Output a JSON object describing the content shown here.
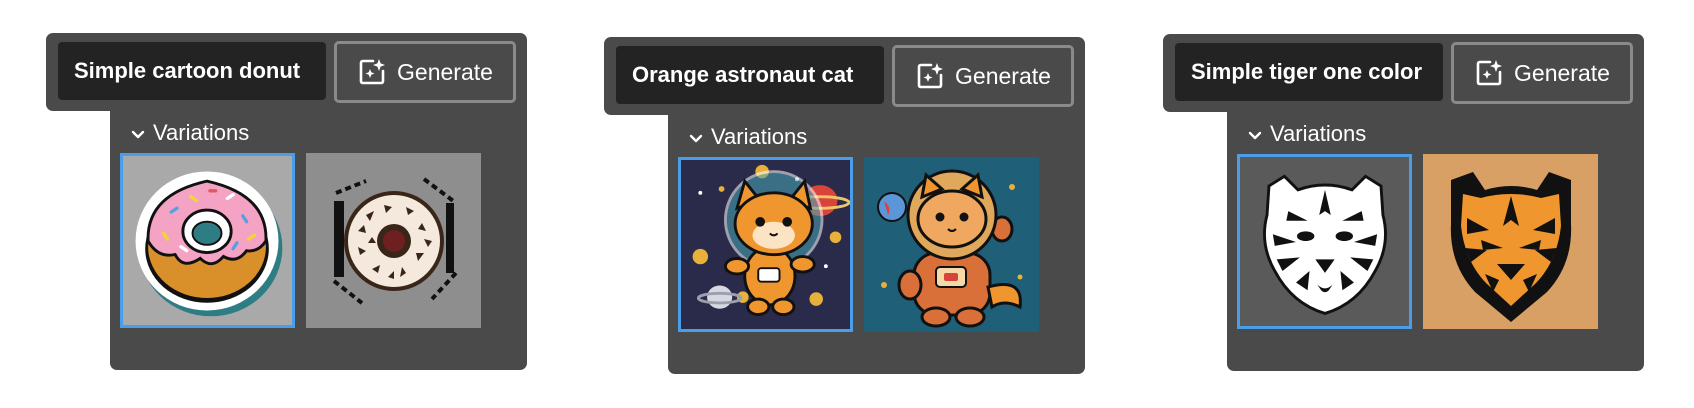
{
  "panels": [
    {
      "prompt": "Simple cartoon donut",
      "generate_label": "Generate",
      "variations_label": "Variations",
      "thumbnails": [
        {
          "name": "donut-sticker",
          "selected": true
        },
        {
          "name": "donut-sprinkle",
          "selected": false
        }
      ]
    },
    {
      "prompt": "Orange astronaut cat",
      "generate_label": "Generate",
      "variations_label": "Variations",
      "thumbnails": [
        {
          "name": "astronaut-cat-space",
          "selected": true
        },
        {
          "name": "astronaut-cat-suit",
          "selected": false
        }
      ]
    },
    {
      "prompt": "Simple tiger one color",
      "generate_label": "Generate",
      "variations_label": "Variations",
      "thumbnails": [
        {
          "name": "tiger-white",
          "selected": true
        },
        {
          "name": "tiger-black-orange",
          "selected": false
        }
      ]
    }
  ],
  "colors": {
    "panel_bg": "#4a4a4a",
    "prompt_bg": "#232323",
    "selection": "#4a9ee8",
    "text": "#ffffff"
  },
  "icons": {
    "generate": "sparkle-image-icon",
    "variations": "chevron-down-icon"
  }
}
